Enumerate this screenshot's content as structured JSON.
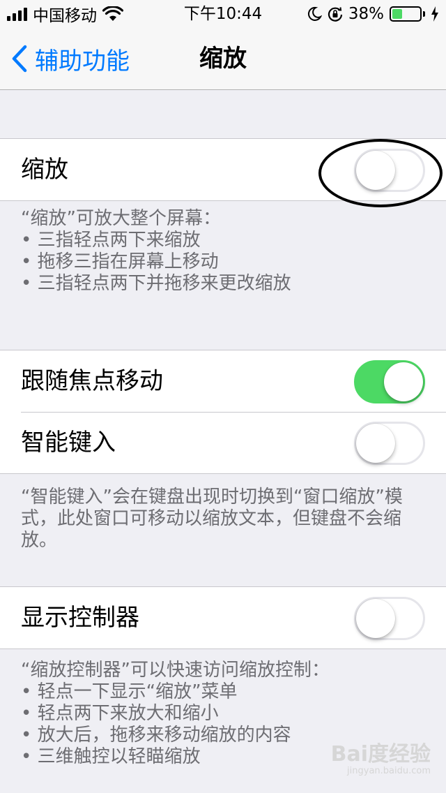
{
  "status_bar": {
    "carrier": "中国移动",
    "time": "下午10:44",
    "battery_percent": "38%",
    "battery_level": 0.38,
    "icons": [
      "signal-icon",
      "wifi-icon",
      "moon-icon",
      "orientation-lock-icon",
      "battery-icon",
      "charging-bolt-icon"
    ]
  },
  "nav": {
    "back_label": "辅助功能",
    "title": "缩放"
  },
  "zoom_section": {
    "label": "缩放",
    "toggle_on": false
  },
  "zoom_footer": {
    "intro": "“缩放”可放大整个屏幕：",
    "bullets": [
      "三指轻点两下来缩放",
      "拖移三指在屏幕上移动",
      "三指轻点两下并拖移来更改缩放"
    ]
  },
  "follow_focus": {
    "label": "跟随焦点移动",
    "toggle_on": true
  },
  "smart_typing": {
    "label": "智能键入",
    "toggle_on": false
  },
  "smart_typing_footer": {
    "text": "“智能键入”会在键盘出现时切换到“窗口缩放”模式，此处窗口可移动以缩放文本，但键盘不会缩放。"
  },
  "controller": {
    "label": "显示控制器",
    "toggle_on": false
  },
  "controller_footer": {
    "intro": "“缩放控制器”可以快速访问缩放控制：",
    "bullets": [
      "轻点一下显示“缩放”菜单",
      "轻点两下来放大和缩小",
      "放大后，拖移来移动缩放的内容",
      "三维触控以轻瞄缩放"
    ]
  },
  "watermark": {
    "text": "Bai度经验",
    "sub": "jingyan.baidu.com"
  },
  "colors": {
    "ios_blue": "#007aff",
    "switch_on_green": "#4cd964",
    "background": "#efeff4"
  }
}
